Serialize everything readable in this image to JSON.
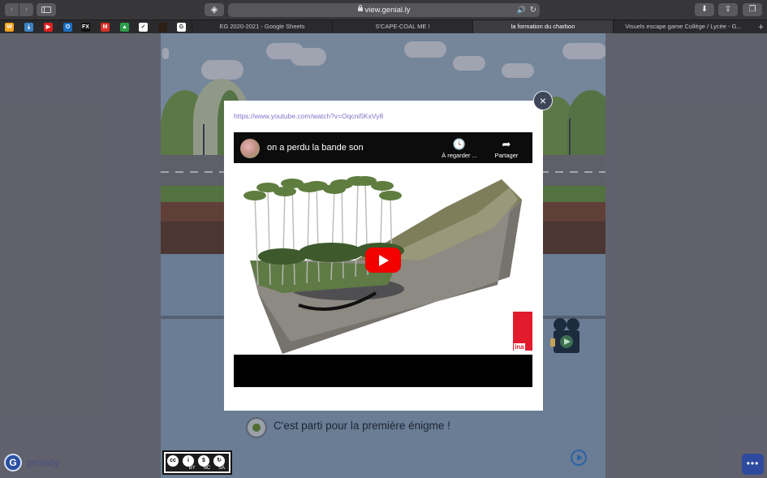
{
  "browser": {
    "address": "view.genial.ly",
    "tabs": [
      {
        "label": "EG 2020-2021 - Google Sheets",
        "active": false
      },
      {
        "label": "S'CAPE-COAL ME !",
        "active": false
      },
      {
        "label": "la formation du charbon",
        "active": true
      },
      {
        "label": "Visuels escape game Collège / Lycée - G...",
        "active": false
      }
    ],
    "bookmarks": [
      {
        "icon": "wp-icon",
        "glyph": "W",
        "color": "#f4a21b"
      },
      {
        "icon": "bookmark-blue-icon",
        "glyph": "⤓",
        "color": "#3b82c4"
      },
      {
        "icon": "youtube-icon",
        "glyph": "▶",
        "color": "#e02020"
      },
      {
        "icon": "outlook-icon",
        "glyph": "O",
        "color": "#1b6fc2"
      },
      {
        "icon": "fx-icon",
        "glyph": "FX",
        "color": "#111111"
      },
      {
        "icon": "gmail-icon",
        "glyph": "M",
        "color": "#d93025"
      },
      {
        "icon": "drive-icon",
        "glyph": "▲",
        "color": "#2d9d4a"
      },
      {
        "icon": "nike-icon",
        "glyph": "✓",
        "color": "#ffffff"
      },
      {
        "icon": "dark-icon",
        "glyph": "",
        "color": "#2b1e14"
      },
      {
        "icon": "google-icon",
        "glyph": "G",
        "color": "#ffffff"
      }
    ]
  },
  "modal": {
    "url": "https://www.youtube.com/watch?v=Oqcni5KxVy8",
    "close_label": "×"
  },
  "video": {
    "title": "on a perdu la bande son",
    "watch_later": "À regarder ...",
    "share": "Partager",
    "logo_text": "ina"
  },
  "slide": {
    "enigma_text": "C'est parti pour la première énigme !",
    "license_labels": [
      "BY",
      "NC",
      "SA"
    ],
    "license_symbols": [
      "cc",
      "i",
      "$",
      "↻"
    ],
    "brand": "genially",
    "brand_letter": "G",
    "more_label": "•••"
  }
}
